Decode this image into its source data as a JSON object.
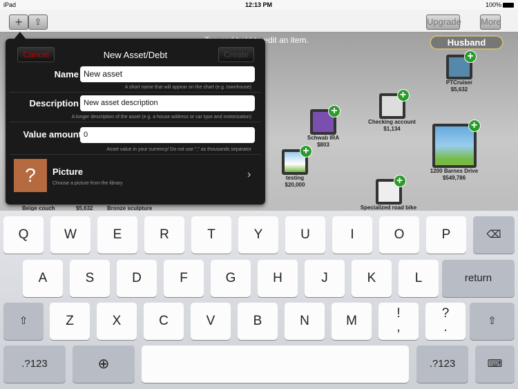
{
  "status": {
    "device": "iPad",
    "time": "12:13 PM",
    "battery": "100%"
  },
  "toolbar": {
    "add": "+",
    "share": "⇪",
    "upgrade": "Upgrade",
    "more": "More"
  },
  "canvas": {
    "hint": "Tap and hold to edit an item.",
    "owner": "Husband",
    "assets": [
      {
        "name": "PTCruiser",
        "value": "$5,632",
        "icon": "car-icon"
      },
      {
        "name": "Checking account",
        "value": "$1,134",
        "icon": "money-bag-icon"
      },
      {
        "name": "Schwab IRA",
        "value": "$803",
        "icon": "chart-icon"
      },
      {
        "name": "1200 Barnes Drive",
        "value": "$549,786",
        "icon": "house-icon"
      },
      {
        "name": "testing",
        "value": "$20,000",
        "icon": "house-icon"
      },
      {
        "name": "Specialized road bike",
        "value": "",
        "icon": "bike-icon"
      }
    ],
    "bottom_labels": [
      "Beige couch",
      "$5,632",
      "Bronze sculpture"
    ]
  },
  "popover": {
    "cancel": "Cancel",
    "title": "New Asset/Debt",
    "create": "Create",
    "name_label": "Name",
    "name_value": "New asset",
    "name_hint": "A short name that will appear on the chart (e.g. townhouse)",
    "desc_label": "Description",
    "desc_value": "New asset description",
    "desc_hint": "A longer description of the asset (e.g. a house address or car type and motorization)",
    "value_label": "Value amount",
    "value_value": "0",
    "value_hint": "Asset  value in  your currency/ Do not use \",\" as thousands separator",
    "picture_title": "Picture",
    "picture_hint": "Choose a picture from the library"
  },
  "keyboard": {
    "row1": [
      "Q",
      "W",
      "E",
      "R",
      "T",
      "Y",
      "U",
      "I",
      "O",
      "P"
    ],
    "row2": [
      "A",
      "S",
      "D",
      "F",
      "G",
      "H",
      "J",
      "K",
      "L"
    ],
    "row3": [
      "Z",
      "X",
      "C",
      "V",
      "B",
      "N",
      "M",
      "!\n,",
      "?\n."
    ],
    "return": "return",
    "numbers": ".?123"
  }
}
